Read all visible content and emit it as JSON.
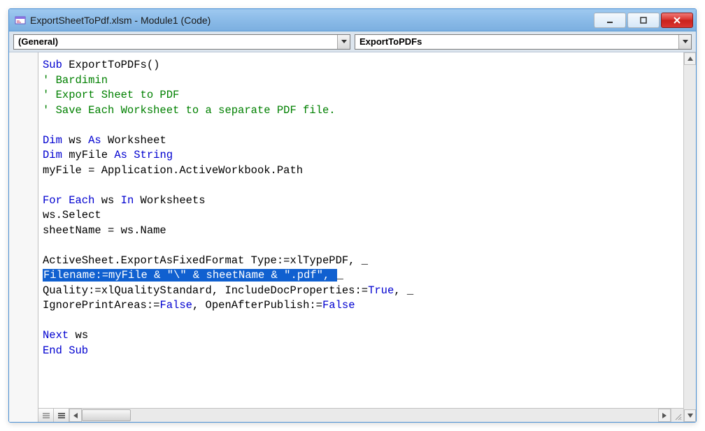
{
  "window": {
    "title": "ExportSheetToPdf.xlsm - Module1 (Code)"
  },
  "dropdowns": {
    "left": "(General)",
    "right": "ExportToPDFs"
  },
  "code": {
    "l1_kw1": "Sub",
    "l1_rest": " ExportToPDFs()",
    "l2": "' Bardimin",
    "l3": "' Export Sheet to PDF",
    "l4": "' Save Each Worksheet to a separate PDF file.",
    "l6_kw1": "Dim",
    "l6_mid": " ws ",
    "l6_kw2": "As",
    "l6_rest": " Worksheet",
    "l7_kw1": "Dim",
    "l7_mid": " myFile ",
    "l7_kw2": "As String",
    "l8": "myFile = Application.ActiveWorkbook.Path",
    "l10_kw1": "For Each",
    "l10_mid": " ws ",
    "l10_kw2": "In",
    "l10_rest": " Worksheets",
    "l11": "ws.Select",
    "l12": "sheetName = ws.Name",
    "l14_a": "ActiveSheet.ExportAsFixedFormat Type:=xlTypePDF, _",
    "l15_sel": "Filename:=myFile & \"\\\" & sheetName & \".pdf\", ",
    "l15_end": "_",
    "l16_a": "Quality:=xlQualityStandard, IncludeDocProperties:=",
    "l16_kw": "True",
    "l16_b": ", _",
    "l17_a": "IgnorePrintAreas:=",
    "l17_kw1": "False",
    "l17_b": ", OpenAfterPublish:=",
    "l17_kw2": "False",
    "l19_kw": "Next",
    "l19_rest": " ws",
    "l20_kw": "End Sub"
  }
}
